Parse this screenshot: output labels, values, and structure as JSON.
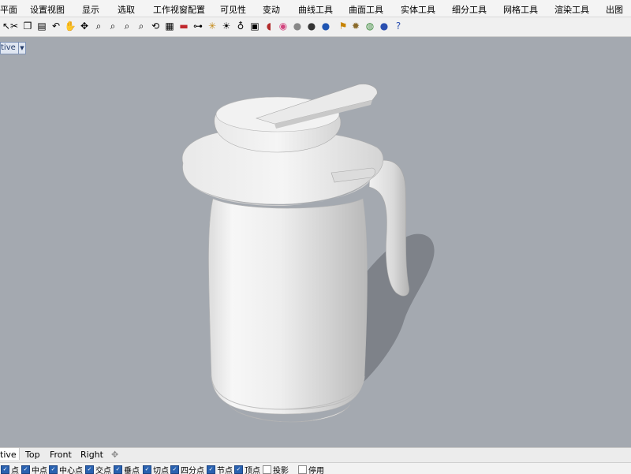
{
  "menu_tabs": [
    "平面",
    "设置视图",
    "显示",
    "选取",
    "工作视窗配置",
    "可见性",
    "变动",
    "曲线工具",
    "曲面工具",
    "实体工具",
    "细分工具",
    "网格工具",
    "渲染工具",
    "出图"
  ],
  "toolbar_icons": [
    "select-icon",
    "cut-icon",
    "copy-icon",
    "paste-icon",
    "undo-icon",
    "pan-hand-icon",
    "move-icon",
    "zoom-icon",
    "zoom-window-icon",
    "zoom-extents-icon",
    "zoom-selected-icon",
    "rotate-view-icon",
    "grid-icon",
    "red-line-icon",
    "car-icon",
    "point-icon",
    "light-icon",
    "lock-icon",
    "paint-icon",
    "color-wheel-icon",
    "sphere-gray-icon",
    "sphere-dark-icon",
    "sphere-blue-icon",
    "flag-icon",
    "gear-icon",
    "globe-icon",
    "help-icon"
  ],
  "viewport": {
    "title": "tive",
    "background": "#a4a9b0"
  },
  "viewport_tabs": [
    "tive",
    "Top",
    "Front",
    "Right"
  ],
  "osnaps": [
    {
      "label": "点",
      "checked": true
    },
    {
      "label": "中点",
      "checked": true
    },
    {
      "label": "中心点",
      "checked": true
    },
    {
      "label": "交点",
      "checked": true
    },
    {
      "label": "垂点",
      "checked": true
    },
    {
      "label": "切点",
      "checked": true
    },
    {
      "label": "四分点",
      "checked": true
    },
    {
      "label": "节点",
      "checked": true
    },
    {
      "label": "顶点",
      "checked": true
    },
    {
      "label": "投影",
      "checked": false
    },
    {
      "label": "停用",
      "checked": false
    }
  ]
}
